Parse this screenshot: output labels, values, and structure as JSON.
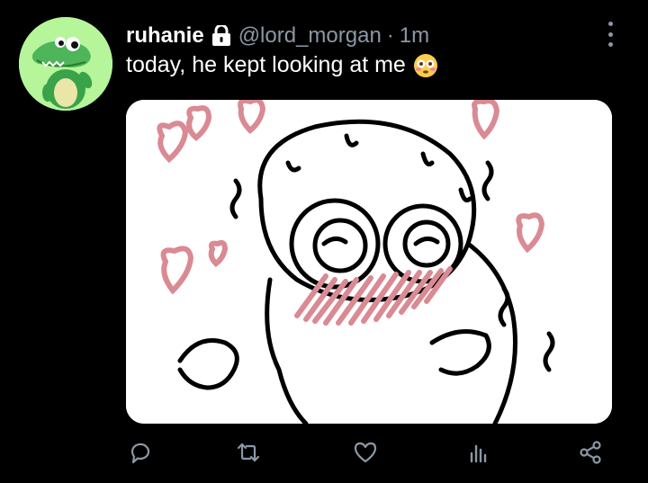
{
  "tweet": {
    "author_name": "ruhanie",
    "handle": "@lord_morgan",
    "separator": "·",
    "time": "1m",
    "text": "today, he kept looking at me",
    "emoji": "flushed-face-emoji",
    "protected": true
  },
  "actions": [
    "reply-icon",
    "retweet-icon",
    "like-icon",
    "analytics-icon",
    "share-icon"
  ],
  "colors": {
    "background": "#000000",
    "secondary_text": "#8b98a5",
    "avatar_bg": "#b6f59a",
    "heart_doodle": "#d98a93"
  }
}
